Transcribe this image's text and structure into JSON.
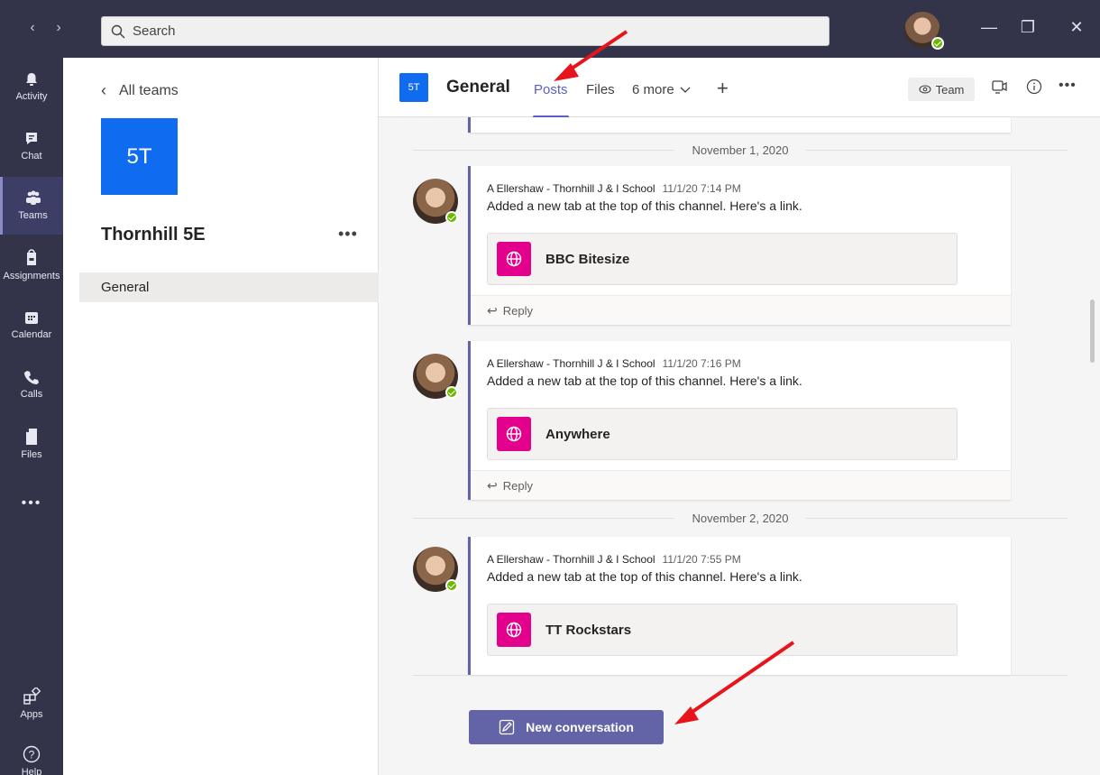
{
  "titlebar": {
    "search_placeholder": "Search",
    "back": "‹",
    "forward": "›",
    "minimize": "—",
    "maximize": "❐",
    "close": "✕"
  },
  "rail": {
    "items": [
      {
        "label": "Activity",
        "icon": "bell-icon"
      },
      {
        "label": "Chat",
        "icon": "chat-icon"
      },
      {
        "label": "Teams",
        "icon": "teams-icon"
      },
      {
        "label": "Assignments",
        "icon": "assignments-icon"
      },
      {
        "label": "Calendar",
        "icon": "calendar-icon"
      },
      {
        "label": "Calls",
        "icon": "phone-icon"
      },
      {
        "label": "Files",
        "icon": "file-icon"
      },
      {
        "label": "Apps",
        "icon": "apps-icon"
      },
      {
        "label": "Help",
        "icon": "help-icon"
      }
    ],
    "more": "•••"
  },
  "channels": {
    "back_label": "All teams",
    "team_initials": "5T",
    "team_name": "Thornhill 5E",
    "more": "•••",
    "items": [
      "General"
    ]
  },
  "header": {
    "badge": "5T",
    "title": "General",
    "tabs": [
      "Posts",
      "Files",
      "6 more"
    ],
    "add": "+",
    "team_button": "Team",
    "more": "•••"
  },
  "feed": {
    "dates": [
      "November 1, 2020",
      "November 2, 2020"
    ],
    "messages": [
      {
        "author": "A Ellershaw - Thornhill J & I School",
        "time": "11/1/20 7:14 PM",
        "text": "Added a new tab at the top of this channel. Here's a link.",
        "link": "BBC Bitesize",
        "reply": "Reply"
      },
      {
        "author": "A Ellershaw - Thornhill J & I School",
        "time": "11/1/20 7:16 PM",
        "text": "Added a new tab at the top of this channel. Here's a link.",
        "link": "Anywhere",
        "reply": "Reply"
      },
      {
        "author": "A Ellershaw - Thornhill J & I School",
        "time": "11/1/20 7:55 PM",
        "text": "Added a new tab at the top of this channel. Here's a link.",
        "link": "TT Rockstars"
      }
    ]
  },
  "compose": {
    "new_conversation": "New conversation"
  },
  "colors": {
    "accent": "#6264a7",
    "rail": "#33344a",
    "team_tile": "#0f6cf0",
    "link_icon": "#e3008c",
    "annotation": "#e8141c"
  }
}
